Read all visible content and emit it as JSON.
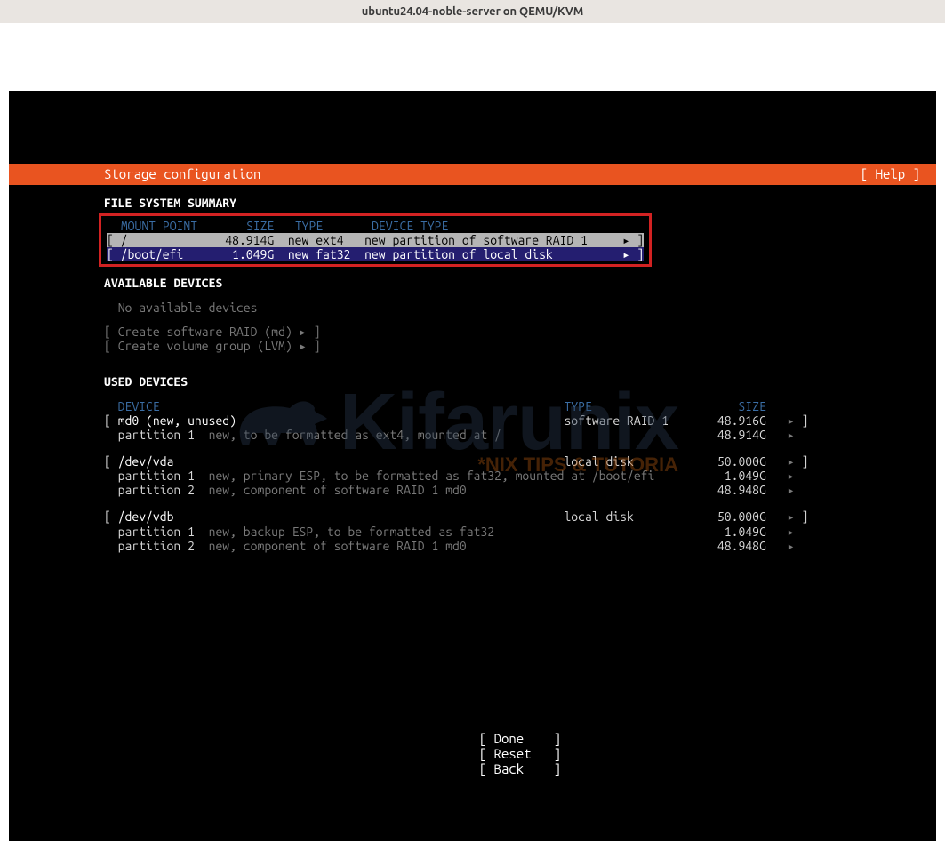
{
  "window": {
    "title": "ubuntu24.04-noble-server on QEMU/KVM"
  },
  "header": {
    "title": "Storage configuration",
    "help": "[ Help ]"
  },
  "sections": {
    "fs_summary": "FILE SYSTEM SUMMARY",
    "available": "AVAILABLE DEVICES",
    "used": "USED DEVICES"
  },
  "fs_headers": {
    "mount": "MOUNT POINT",
    "size": "SIZE",
    "type": "TYPE",
    "devtype": "DEVICE TYPE"
  },
  "fs_rows": [
    {
      "mount": "/",
      "size": "48.914G",
      "type": "new ext4",
      "devtype": "new partition of software RAID 1",
      "selected": true
    },
    {
      "mount": "/boot/efi",
      "size": "1.049G",
      "type": "new fat32",
      "devtype": "new partition of local disk",
      "selected": false
    }
  ],
  "available": {
    "none": "No available devices",
    "raid": "[ Create software RAID (md) ▸ ]",
    "lvm": "[ Create volume group (LVM) ▸ ]"
  },
  "used_headers": {
    "device": "DEVICE",
    "type": "TYPE",
    "size": "SIZE"
  },
  "used": [
    {
      "head": {
        "name": "md0 (new, unused)",
        "type": "software RAID 1",
        "size": "48.916G"
      },
      "parts": [
        {
          "label": "partition 1",
          "desc": "new, to be formatted as ext4, mounted at /",
          "size": "48.914G"
        }
      ]
    },
    {
      "head": {
        "name": "/dev/vda",
        "type": "local disk",
        "size": "50.000G"
      },
      "parts": [
        {
          "label": "partition 1",
          "desc": "new, primary ESP, to be formatted as fat32, mounted at /boot/efi",
          "size": "1.049G"
        },
        {
          "label": "partition 2",
          "desc": "new, component of software RAID 1 md0",
          "size": "48.948G"
        }
      ]
    },
    {
      "head": {
        "name": "/dev/vdb",
        "type": "local disk",
        "size": "50.000G"
      },
      "parts": [
        {
          "label": "partition 1",
          "desc": "new, backup ESP, to be formatted as fat32",
          "size": "1.049G"
        },
        {
          "label": "partition 2",
          "desc": "new, component of software RAID 1 md0",
          "size": "48.948G"
        }
      ]
    }
  ],
  "buttons": {
    "done": "Done",
    "reset": "Reset",
    "back": "Back"
  },
  "watermark": {
    "brand": "Kifarunix",
    "tag": "*NIX TIPS & TUTORIA"
  },
  "glyphs": {
    "arrow": "▸"
  }
}
